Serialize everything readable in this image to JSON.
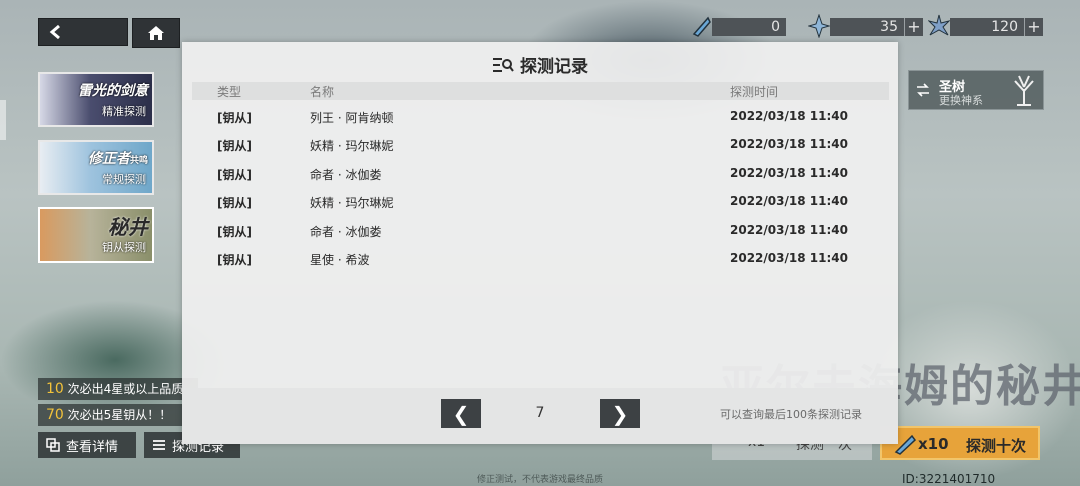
{
  "header": {
    "resources": [
      {
        "icon": "gem-icon",
        "value": "0"
      },
      {
        "icon": "star-crystal-icon",
        "value": "35"
      },
      {
        "icon": "spark-crystal-icon",
        "value": "120"
      }
    ],
    "plus_label": "+"
  },
  "banners": [
    {
      "title": "雷光的剑意",
      "sub": "精准探测",
      "accent": "#2c2f4a"
    },
    {
      "title": "修正者",
      "badge": "共鸣",
      "sub": "常规探测",
      "accent": "#6fa7c9"
    },
    {
      "title": "秘井",
      "sub": "钥从探测",
      "accent": "#8a8f6a"
    }
  ],
  "tree_card": {
    "name": "圣树",
    "sub": "更换神系"
  },
  "pity": [
    {
      "num": "10",
      "text": "次必出4星或以上品质"
    },
    {
      "num": "70",
      "text": "次必出5星钥从！！"
    }
  ],
  "bottom_buttons": {
    "details": "查看详情",
    "records": "探测记录"
  },
  "big_title": "亚尔夫海姆的秘井",
  "pull_one": {
    "count": "x1",
    "label": "探测一次"
  },
  "pull_ten": {
    "count": "x10",
    "label": "探测十次"
  },
  "disclaimer": "修正测试，不代表游戏最终品质",
  "uid": "ID:3221401710",
  "dialog": {
    "title": "探测记录",
    "columns": {
      "type": "类型",
      "name": "名称",
      "time": "探测时间"
    },
    "rows": [
      {
        "type": "[钥从]",
        "name": "列王 · 阿肯纳顿",
        "time": "2022/03/18 11:40"
      },
      {
        "type": "[钥从]",
        "name": "妖精 · 玛尔琳妮",
        "time": "2022/03/18 11:40"
      },
      {
        "type": "[钥从]",
        "name": "命者 · 冰伽娄",
        "time": "2022/03/18 11:40"
      },
      {
        "type": "[钥从]",
        "name": "妖精 · 玛尔琳妮",
        "time": "2022/03/18 11:40"
      },
      {
        "type": "[钥从]",
        "name": "命者 · 冰伽娄",
        "time": "2022/03/18 11:40"
      },
      {
        "type": "[钥从]",
        "name": "星使 · 希波",
        "time": "2022/03/18 11:40"
      }
    ],
    "pager": {
      "prev": "❮",
      "page": "7",
      "next": "❯",
      "note": "可以查询最后100条探测记录"
    }
  }
}
